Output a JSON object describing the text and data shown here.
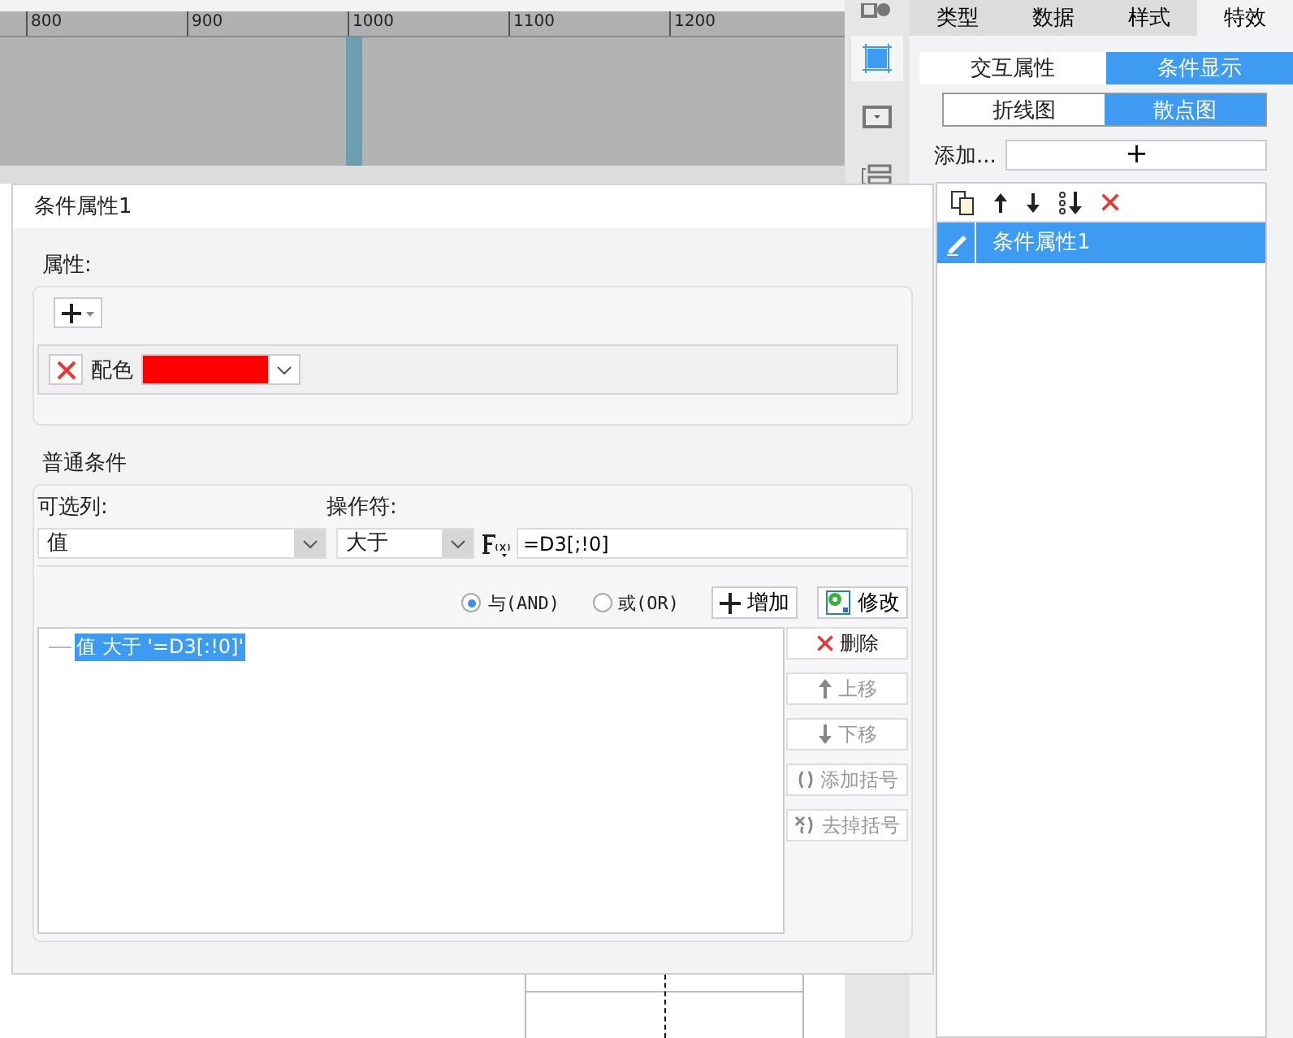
{
  "ruler": {
    "ticks": [
      "800",
      "900",
      "1000",
      "1100",
      "1200"
    ]
  },
  "panel": {
    "tabs": [
      {
        "label": "类型",
        "selected": false
      },
      {
        "label": "数据",
        "selected": false
      },
      {
        "label": "样式",
        "selected": false
      },
      {
        "label": "特效",
        "selected": true
      }
    ],
    "subtabs": [
      {
        "label": "交互属性",
        "selected": false
      },
      {
        "label": "条件显示",
        "selected": true
      }
    ],
    "chart_tabs": [
      {
        "label": "折线图",
        "selected": false
      },
      {
        "label": "散点图",
        "selected": true
      }
    ],
    "add_label": "添加...",
    "add_button": "+",
    "items": [
      {
        "label": "条件属性1",
        "selected": true
      }
    ]
  },
  "dialog": {
    "title": "条件属性1",
    "attributes": {
      "legend": "属性:",
      "rows": [
        {
          "kind": "color",
          "label": "配色",
          "color": "#ff0000"
        }
      ]
    },
    "conditions": {
      "legend": "普通条件",
      "column_label": "可选列:",
      "column_value": "值",
      "operator_label": "操作符:",
      "operator_value": "大于",
      "formula": "=D3[;!0]",
      "logic": [
        {
          "label": "与(AND)",
          "selected": true
        },
        {
          "label": "或(OR)",
          "selected": false
        }
      ],
      "add_button": "增加",
      "modify_button": "修改",
      "tree": [
        {
          "label": "值 大于 '=D3[:!0]'",
          "selected": true
        }
      ],
      "side_buttons": [
        {
          "kind": "delete",
          "label": "删除",
          "disabled": false
        },
        {
          "kind": "up",
          "label": "上移",
          "disabled": true
        },
        {
          "kind": "down",
          "label": "下移",
          "disabled": true
        },
        {
          "kind": "paren",
          "label": "添加括号",
          "disabled": true
        },
        {
          "kind": "unparen",
          "label": "去掉括号",
          "disabled": true
        }
      ]
    }
  }
}
